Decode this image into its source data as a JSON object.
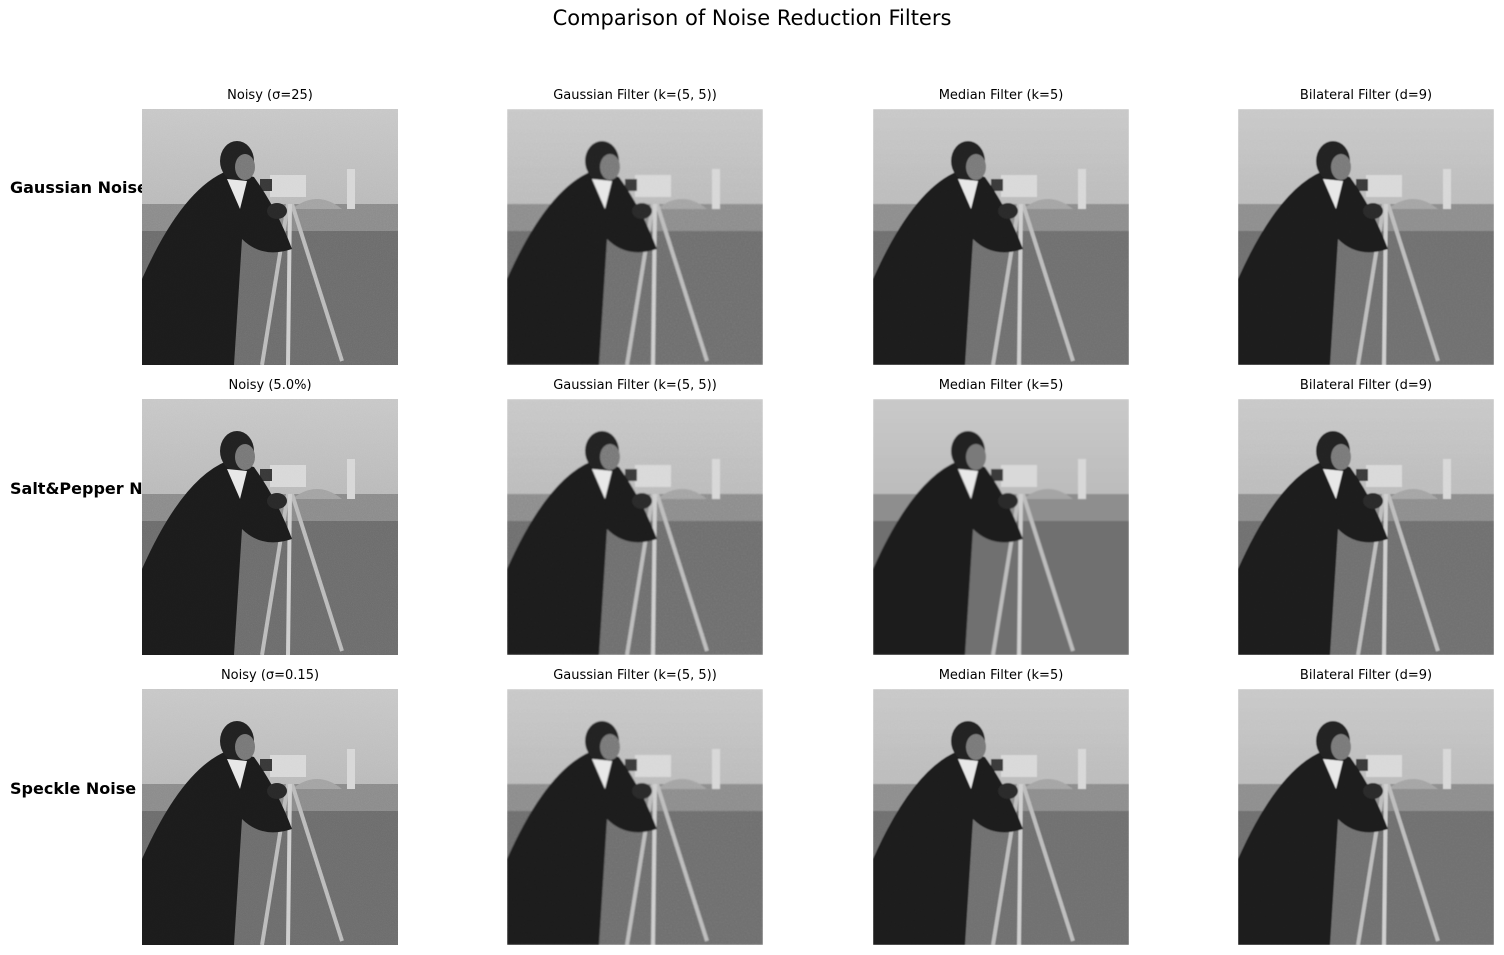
{
  "figure": {
    "title": "Comparison of Noise Reduction Filters"
  },
  "rows": [
    {
      "label": "Gaussian Noise ->",
      "panels": [
        {
          "title": "Noisy (σ=25)",
          "filter": "noisy",
          "noise": "gaussian"
        },
        {
          "title": "Gaussian Filter (k=(5, 5))",
          "filter": "gaussian",
          "noise": "gaussian"
        },
        {
          "title": "Median Filter (k=5)",
          "filter": "median",
          "noise": "gaussian"
        },
        {
          "title": "Bilateral Filter (d=9)",
          "filter": "bilateral",
          "noise": "gaussian"
        }
      ]
    },
    {
      "label": "Salt&Pepper Noise ->",
      "panels": [
        {
          "title": "Noisy (5.0%)",
          "filter": "noisy",
          "noise": "saltpepper"
        },
        {
          "title": "Gaussian Filter (k=(5, 5))",
          "filter": "gaussian",
          "noise": "saltpepper"
        },
        {
          "title": "Median Filter (k=5)",
          "filter": "median",
          "noise": "saltpepper"
        },
        {
          "title": "Bilateral Filter (d=9)",
          "filter": "bilateral",
          "noise": "saltpepper"
        }
      ]
    },
    {
      "label": "Speckle Noise ->",
      "panels": [
        {
          "title": "Noisy (σ=0.15)",
          "filter": "noisy",
          "noise": "speckle"
        },
        {
          "title": "Gaussian Filter (k=(5, 5))",
          "filter": "gaussian",
          "noise": "speckle"
        },
        {
          "title": "Median Filter (k=5)",
          "filter": "median",
          "noise": "speckle"
        },
        {
          "title": "Bilateral Filter (d=9)",
          "filter": "bilateral",
          "noise": "speckle"
        }
      ]
    }
  ]
}
